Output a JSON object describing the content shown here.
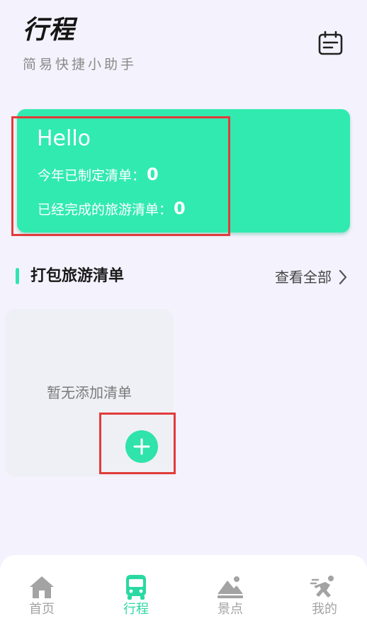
{
  "header": {
    "title": "行程",
    "subtitle": "简易快捷小助手",
    "calendar_icon": "calendar-icon"
  },
  "hero": {
    "greeting": "Hello",
    "stat_created_label": "今年已制定清单：",
    "stat_created_value": "0",
    "stat_done_label": "已经完成的旅游清单：",
    "stat_done_value": "0"
  },
  "section": {
    "title": "打包旅游清单",
    "view_all": "查看全部"
  },
  "list": {
    "empty_text": "暂无添加清单"
  },
  "tabs": [
    {
      "label": "首页",
      "icon": "home-icon",
      "active": false
    },
    {
      "label": "行程",
      "icon": "bus-icon",
      "active": true
    },
    {
      "label": "景点",
      "icon": "mountain-icon",
      "active": false
    },
    {
      "label": "我的",
      "icon": "runner-icon",
      "active": false
    }
  ],
  "colors": {
    "accent": "#31eab0",
    "background": "#f4f2fd",
    "highlight": "#e23b3b",
    "tab_inactive": "#a3a3a3"
  }
}
